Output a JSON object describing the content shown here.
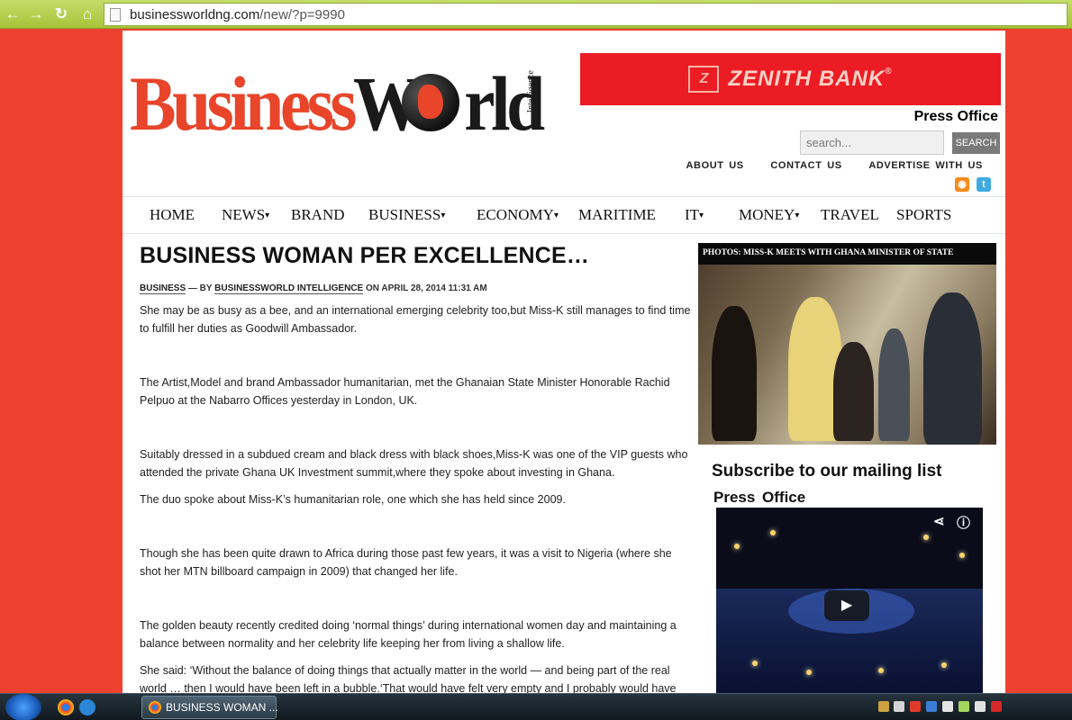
{
  "browser": {
    "url_domain": "businessworldng.com",
    "url_path": "/new/?p=9990"
  },
  "header": {
    "logo_text_a": "Business",
    "logo_text_b": "W",
    "logo_text_c": "rld",
    "logo_intelligence": "Intelligence",
    "banner_logo": "Z",
    "banner_text": "ZENITH BANK",
    "banner_reg": "®",
    "press_office": "Press Office",
    "search_placeholder": "search...",
    "search_button": "SEARCH",
    "links": [
      "ABOUT US",
      "CONTACT US",
      "ADVERTISE WITH US"
    ]
  },
  "nav": {
    "items": [
      "HOME",
      "NEWS",
      "BRAND",
      "BUSINESS",
      "ECONOMY",
      "MARITIME",
      "IT",
      "MONEY",
      "TRAVEL",
      "SPORTS"
    ],
    "caret": "▾"
  },
  "article": {
    "headline": "BUSINESS WOMAN PER EXCELLENCE…",
    "meta_category": "BUSINESS",
    "meta_by": " — BY ",
    "meta_author": "BUSINESSWORLD INTELLIGENCE",
    "meta_on": " ON APRIL 28, 2014 11:31 AM",
    "paragraphs": [
      "She may be as busy as a bee, and an international emerging celebrity too,but Miss-K still manages to find time to fulfill her duties as Goodwill Ambassador.",
      "The Artist,Model and brand Ambassador humanitarian, met the Ghanaian State Minister Honorable Rachid Pelpuo at the Nabarro Offices yesterday in London, UK.",
      "Suitably dressed in a subdued cream and black dress with black shoes,Miss-K was one of the VIP guests who attended the private Ghana UK Investment summit,where they spoke about investing in Ghana.",
      "The duo spoke about Miss-K’s humanitarian role, one which she has held since 2009.",
      "Though she has been quite drawn to Africa during those past few years, it was a visit to Nigeria (where she shot her MTN billboard campaign in 2009) that changed her life.",
      "The golden beauty recently credited doing ‘normal things’ during international women day and maintaining a balance between normality and her celebrity life keeping her from living a shallow life.",
      "She said: ‘Without the balance of doing things that actually matter in the world — and being part of the real world … then I would have been left in a bubble.‘That would have felt very empty and I probably would have just had a"
    ]
  },
  "sidebar": {
    "photo_caption": "PHOTOS: MISS-K MEETS WITH GHANA MINISTER OF STATE",
    "subscribe_title": "Subscribe to our mailing list",
    "press_office": "Press  Office"
  },
  "taskbar": {
    "active_window": "BUSINESS WOMAN ..."
  },
  "colors": {
    "page_bg": "#ef4130",
    "brand_red": "#e8452a",
    "banner_red": "#ec1c24",
    "chrome_green": "#b5cd4d"
  }
}
